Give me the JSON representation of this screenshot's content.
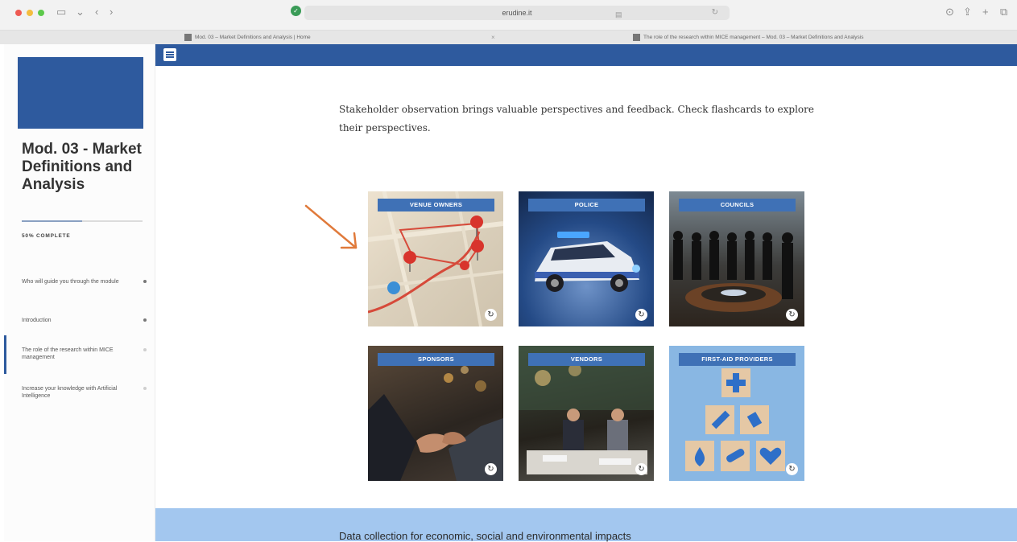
{
  "browser": {
    "address": "erudine.it",
    "tabs": [
      {
        "label": "Mod. 03 – Market Definitions and Analysis | Home"
      },
      {
        "label": "The role of the research within MICE management – Mod. 03 – Market Definitions and Analysis"
      }
    ]
  },
  "sidebar": {
    "course_title": "Mod. 03 - Market Definitions and Analysis",
    "progress_label": "50% COMPLETE",
    "progress": 0.5,
    "items": [
      {
        "label": "Who will guide you through the module"
      },
      {
        "label": "Introduction"
      },
      {
        "label": "The role of the research within MICE management"
      },
      {
        "label": "Increase your knowledge with Artificial Intelligence"
      }
    ]
  },
  "main": {
    "intro": "Stakeholder observation brings valuable perspectives and feedback. Check flashcards to explore their perspectives.",
    "cards": [
      {
        "label": "VENUE OWNERS"
      },
      {
        "label": "POLICE"
      },
      {
        "label": "COUNCILS"
      },
      {
        "label": "SPONSORS"
      },
      {
        "label": "VENDORS"
      },
      {
        "label": "FIRST-AID PROVIDERS"
      }
    ],
    "next_section_title": "Data collection for economic, social and environmental impacts"
  },
  "colors": {
    "brand": "#2e5a9e",
    "card_label": "#3f71b6",
    "section_band": "#a3c7ef",
    "arrow": "#e07a3b"
  }
}
